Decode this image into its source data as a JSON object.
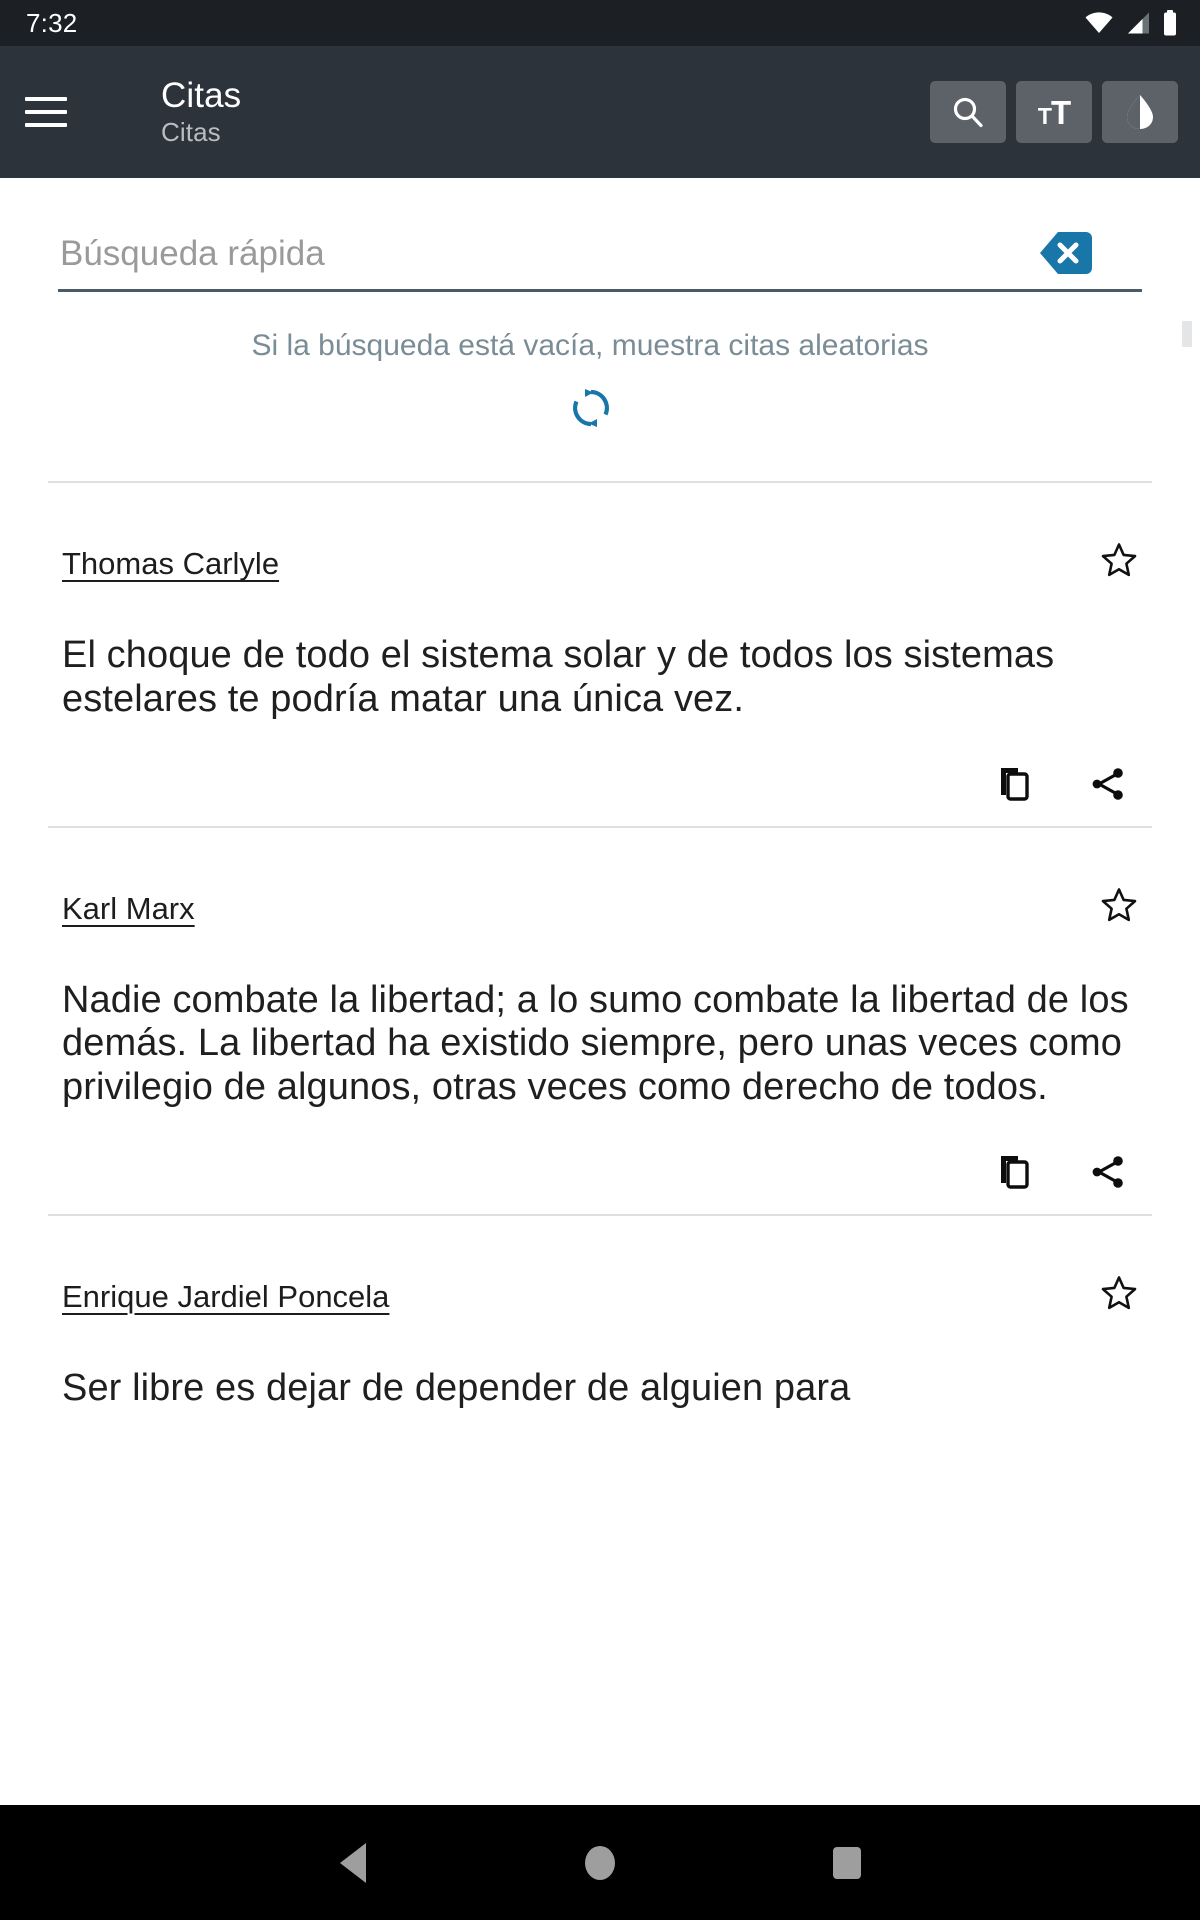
{
  "status_bar": {
    "time": "7:32",
    "icons": [
      "wifi-icon",
      "cellular-signal-icon",
      "battery-icon"
    ]
  },
  "app_bar": {
    "menu_icon": "hamburger-menu-icon",
    "title": "Citas",
    "subtitle": "Citas",
    "actions": [
      {
        "name": "search-button",
        "icon": "search-icon",
        "label": ""
      },
      {
        "name": "text-size-button",
        "icon": "text-size-icon",
        "small": "T",
        "big": "T"
      },
      {
        "name": "theme-contrast-button",
        "icon": "contrast-droplet-icon",
        "label": ""
      }
    ]
  },
  "search": {
    "value": "",
    "placeholder": "Búsqueda rápida",
    "clear_icon": "clear-x-icon",
    "hint": "Si la búsqueda está vacía, muestra citas aleatorias",
    "refresh_icon": "refresh-icon",
    "accent_color": "#1976a8",
    "underline_color": "#4a5a66",
    "hint_color": "#7a8c96"
  },
  "quotes": [
    {
      "author": "Thomas Carlyle",
      "text": "El choque de todo el sistema solar y de todos los sistemas estelares te podría matar una única vez.",
      "favorite": false,
      "star_icon": "star-outline-icon",
      "copy_icon": "copy-icon",
      "share_icon": "share-icon"
    },
    {
      "author": "Karl Marx",
      "text": "Nadie combate la libertad; a lo sumo combate la libertad de los demás. La libertad ha existido siempre, pero unas veces como privilegio de algunos, otras veces como derecho de todos.",
      "favorite": false,
      "star_icon": "star-outline-icon",
      "copy_icon": "copy-icon",
      "share_icon": "share-icon"
    },
    {
      "author": "Enrique Jardiel Poncela",
      "text": "Ser libre es dejar de depender de alguien para",
      "favorite": false,
      "star_icon": "star-outline-icon",
      "copy_icon": "copy-icon",
      "share_icon": "share-icon"
    }
  ],
  "nav_bar": {
    "back": "back-button",
    "home": "home-button",
    "recents": "recents-button"
  }
}
